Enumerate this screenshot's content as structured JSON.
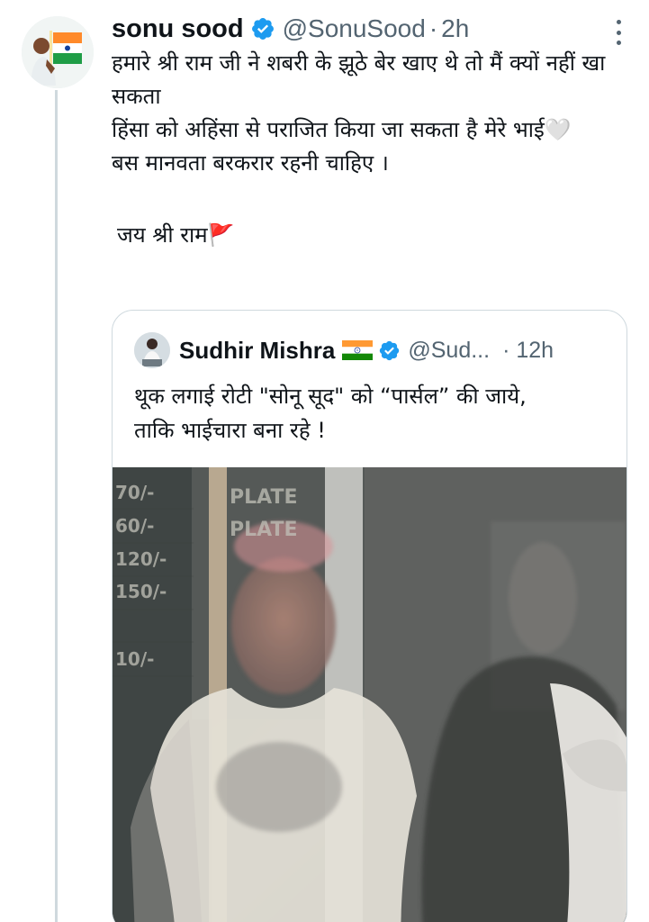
{
  "tweet": {
    "display_name": "sonu sood",
    "handle": "@SonuSood",
    "separator": "·",
    "time": "2h",
    "lines": [
      "हमारे श्री राम जी ने शबरी के झूठे बेर खाए थे तो मैं क्यों नहीं खा सकता",
      "हिंसा को अहिंसा से पराजित किया जा सकता है मेरे भाई🤍",
      "बस मानवता बरकरार रहनी चाहिए ।",
      "जय श्री राम🚩"
    ]
  },
  "quote": {
    "display_name": "Sudhir Mishra",
    "flag": "🇮🇳",
    "handle": "@Sud...",
    "separator": "·",
    "time": "12h",
    "lines": [
      "थूक लगाई रोटी \"सोनू सूद\" को “पार्सल” की जाये,",
      "ताकि भाईचारा बना रहे !"
    ],
    "media_text": {
      "sign_1": "PLATE",
      "sign_2": "PLATE",
      "prices": [
        "70/-",
        "60/-",
        "120/-",
        "150/-",
        "",
        "10/-"
      ]
    }
  },
  "icons": {
    "verified": "verified-badge-icon",
    "more": "more-options-icon",
    "flag": "india-flag-icon"
  },
  "colors": {
    "accent": "#1d9bf0",
    "text": "#0f1419",
    "muted": "#536471",
    "border": "#cfd9de"
  }
}
